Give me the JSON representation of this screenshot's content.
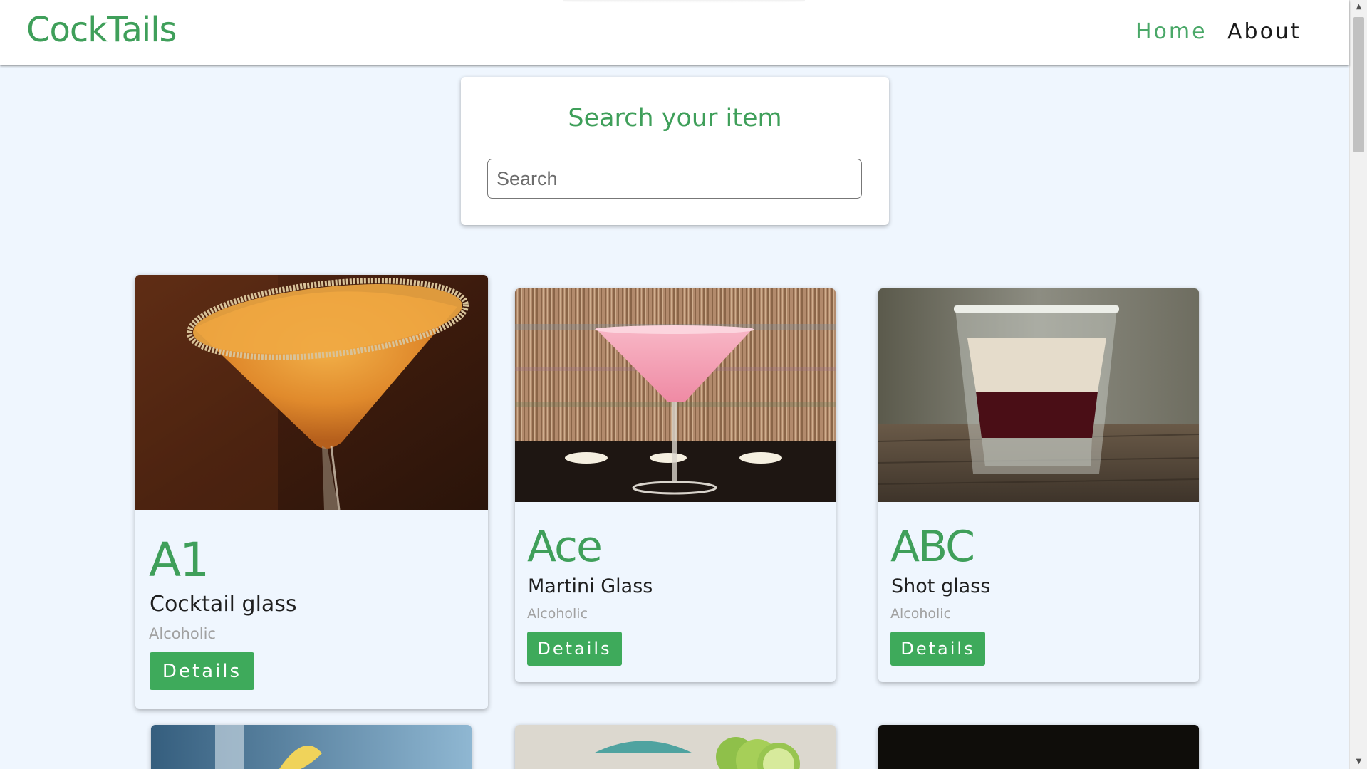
{
  "navbar": {
    "brand": "CockTails",
    "links": [
      {
        "label": "Home",
        "active": true
      },
      {
        "label": "About",
        "active": false
      }
    ]
  },
  "search": {
    "title": "Search your item",
    "placeholder": "Search",
    "value": ""
  },
  "cards": [
    {
      "name": "A1",
      "glass": "Cocktail glass",
      "type": "Alcoholic",
      "button": "Details",
      "image": "orange-martini-photo"
    },
    {
      "name": "Ace",
      "glass": "Martini Glass",
      "type": "Alcoholic",
      "button": "Details",
      "image": "pink-martini-photo"
    },
    {
      "name": "ABC",
      "glass": "Shot glass",
      "type": "Alcoholic",
      "button": "Details",
      "image": "layered-shot-photo"
    }
  ],
  "colors": {
    "accent": "#3f9f5a",
    "button": "#3eaa5b",
    "page_bg": "#eff6fe",
    "muted_text": "#a1a1a1"
  }
}
